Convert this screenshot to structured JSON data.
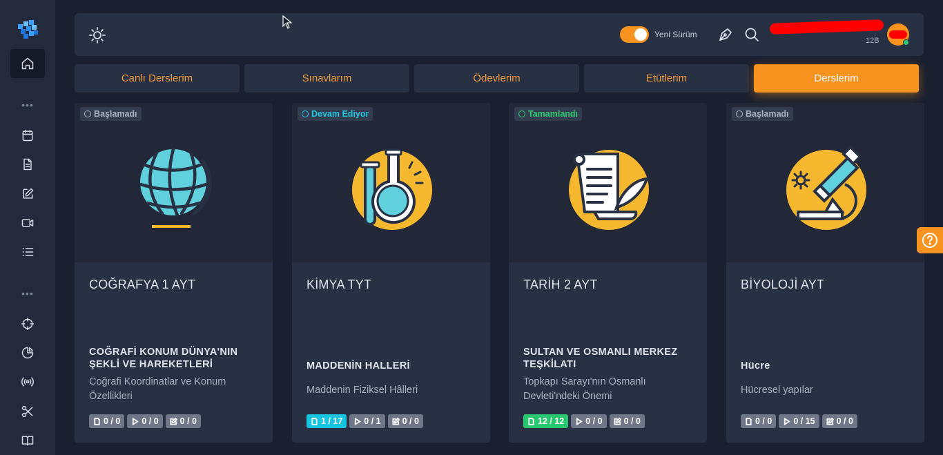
{
  "topbar": {
    "toggle_label": "Yeni Sürüm",
    "user_class": "12B"
  },
  "tabs": [
    {
      "label": "Canlı Derslerim",
      "active": false
    },
    {
      "label": "Sınavlarım",
      "active": false
    },
    {
      "label": "Ödevlerim",
      "active": false
    },
    {
      "label": "Etütlerim",
      "active": false
    },
    {
      "label": "Derslerim",
      "active": true
    }
  ],
  "cards": [
    {
      "status": "Başlamadı",
      "title": "COĞRAFYA 1 AYT",
      "topic": "COĞRAFİ KONUM DÜNYA'NIN ŞEKLİ VE HAREKETLERİ",
      "description": "Coğrafi Koordinatlar ve Konum Özellikleri",
      "icon": "globe-icon",
      "badges": [
        "0 / 0",
        "0 / 0",
        "0 / 0"
      ]
    },
    {
      "status": "Devam Ediyor",
      "title": "KİMYA TYT",
      "topic": "MADDENİN HALLERİ",
      "description": "Maddenin Fiziksel Hâlleri",
      "icon": "flask-icon",
      "badges": [
        "1 / 17",
        "0 / 1",
        "0 / 0"
      ]
    },
    {
      "status": "Tamamlandı",
      "title": "TARİH 2 AYT",
      "topic": "SULTAN VE OSMANLI MERKEZ TEŞKİLATI",
      "description": "Topkapı Sarayı'nın Osmanlı Devleti'ndeki Önemi",
      "icon": "scroll-icon",
      "badges": [
        "12 / 12",
        "0 / 0",
        "0 / 0"
      ]
    },
    {
      "status": "Başlamadı",
      "title": "BİYOLOJİ AYT",
      "topic": "Hücre",
      "description": "Hücresel yapılar",
      "icon": "microscope-icon",
      "badges": [
        "0 / 0",
        "0 / 15",
        "0 / 0"
      ]
    }
  ],
  "colors": {
    "accent": "#f7931e",
    "status_not_started": "#aab1c1",
    "status_in_progress": "#1ec8e0",
    "status_completed": "#2ecc71"
  },
  "sidebar_icons": [
    "home-icon",
    "calendar-icon",
    "document-icon",
    "edit-icon",
    "video-icon",
    "list-icon",
    "crosshair-icon",
    "pie-chart-icon",
    "broadcast-icon",
    "scissors-icon",
    "book-icon"
  ]
}
